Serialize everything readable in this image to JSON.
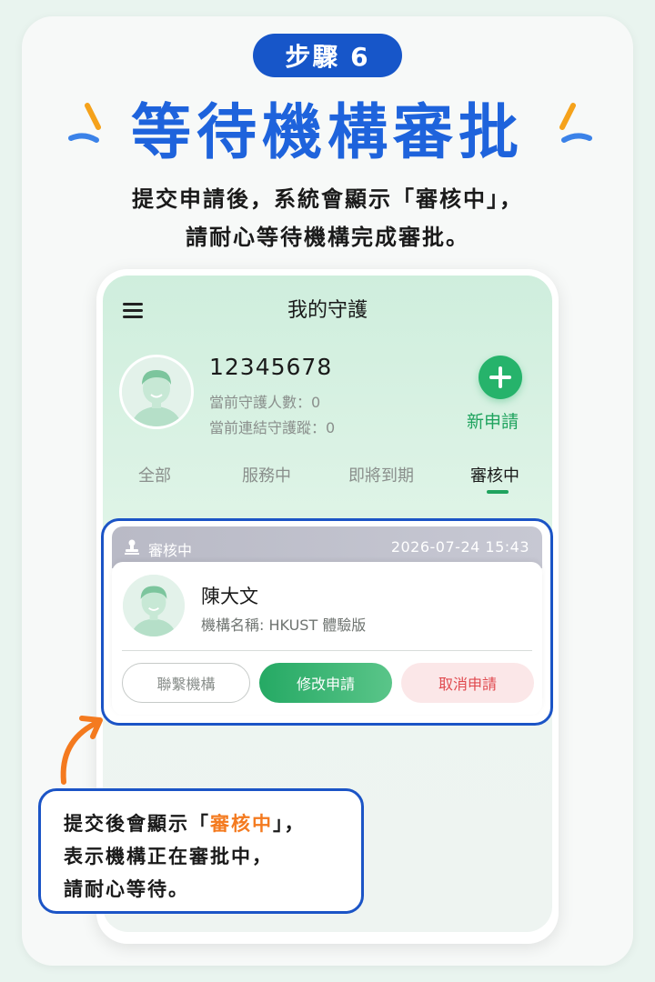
{
  "step_badge": "步驟 6",
  "title": "等待機構審批",
  "subtitle": {
    "line1": "提交申請後，系統會顯示「審核中」，",
    "line2": "請耐心等待機構完成審批。"
  },
  "app": {
    "title": "我的守護",
    "user": {
      "id": "12345678",
      "guardians": "當前守護人數：0",
      "links": "當前連結守護蹤：0"
    },
    "new_button_label": "新申請",
    "tabs": [
      {
        "label": "全部",
        "active": false
      },
      {
        "label": "服務中",
        "active": false
      },
      {
        "label": "即將到期",
        "active": false
      },
      {
        "label": "審核中",
        "active": true
      }
    ],
    "application": {
      "status": "審核中",
      "datetime": "2026-07-24 15:43",
      "name": "陳大文",
      "org": "機構名稱: HKUST 體驗版",
      "actions": {
        "contact": "聯繫機構",
        "edit": "修改申請",
        "cancel": "取消申請"
      }
    }
  },
  "callout": {
    "line1_pre": "提交後會顯示「",
    "line1_highlight": "審核中",
    "line1_post": "」，",
    "line2": "表示機構正在審批中，",
    "line3": "請耐心等待。"
  },
  "colors": {
    "brand_blue": "#1e63dc",
    "badge_blue": "#1756c9",
    "green": "#26b36b",
    "highlight_orange": "#f47a1f",
    "cancel_red": "#e04a4f"
  }
}
